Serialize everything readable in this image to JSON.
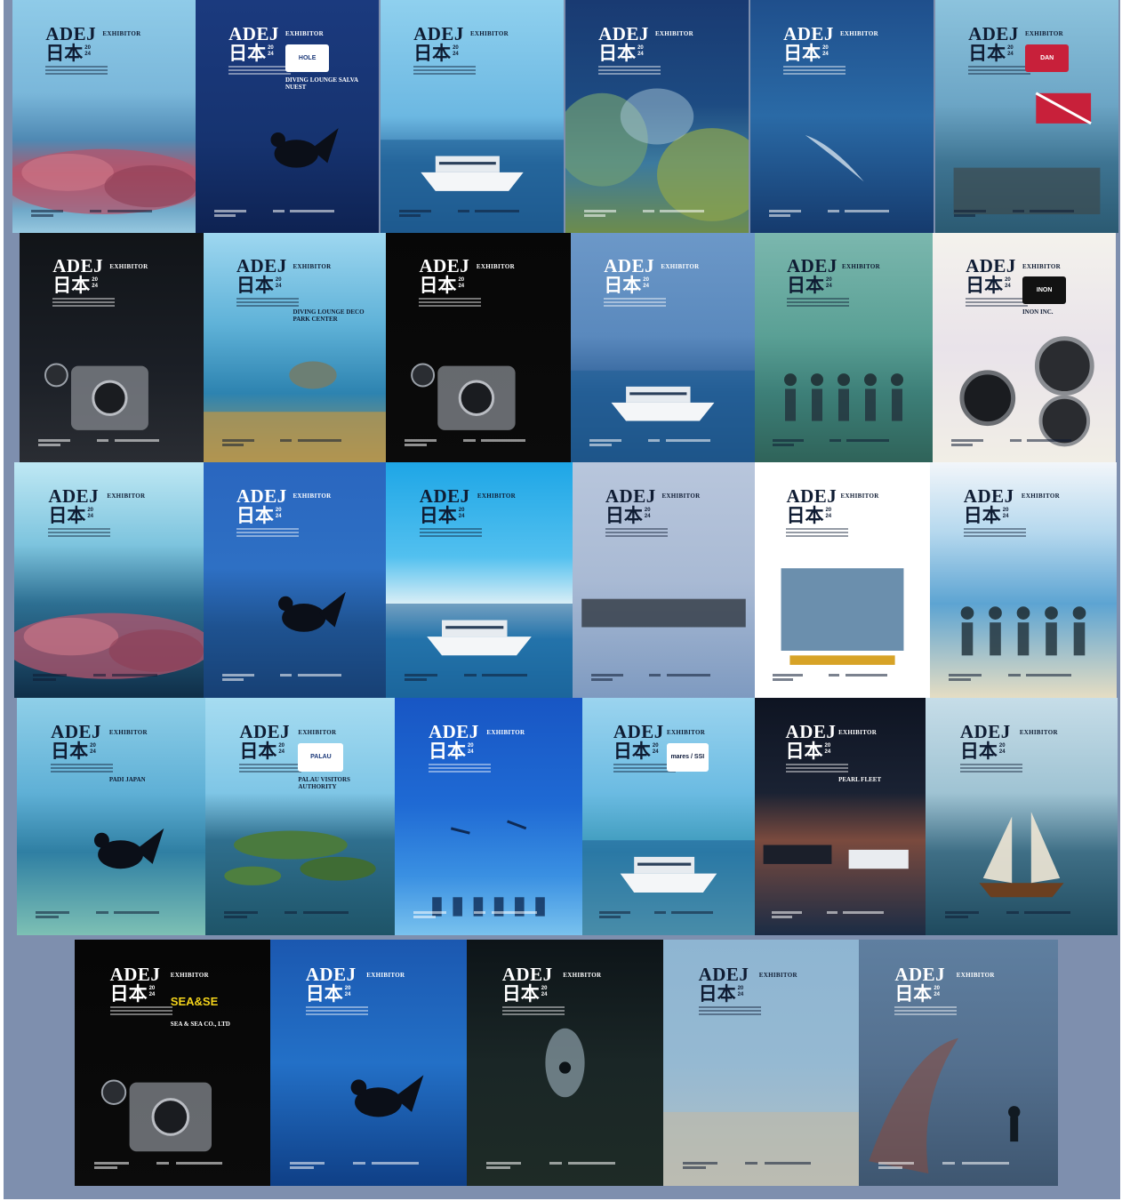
{
  "posters": [
    {
      "row": 1,
      "tag": "EXHIBITOR",
      "logo": "",
      "exhibitor": "",
      "bg": "linear-gradient(180deg,#8fcbe8 0%,#7ab7da 40%,#4f89b3 60%,#b5566a 75%,#6fa8c8 90%,#97c8e0 100%)",
      "text": "#0f1c33",
      "subject": "reef"
    },
    {
      "row": 1,
      "tag": "EXHIBITOR",
      "logo": "HOLE",
      "exhibitor": "DIVING LOUNGE SALVA NUEST",
      "bg": "linear-gradient(180deg,#1b3a7e 0%,#163370 60%,#0e2252 100%)",
      "text": "#ffffff",
      "subject": "diver"
    },
    {
      "row": 1,
      "tag": "EXHIBITOR",
      "logo": "",
      "exhibitor": "",
      "bg": "linear-gradient(180deg,#8fd0ee 0%,#6cb8e2 50%,#2f6fa4 70%,#1f5487 100%)",
      "text": "#0f1c33",
      "subject": "yacht"
    },
    {
      "row": 1,
      "tag": "EXHIBITOR",
      "logo": "",
      "exhibitor": "",
      "bg": "linear-gradient(180deg,#193a72 0%,#1d4b82 45%,#3c7a9e 70%,#6d8c4c 100%)",
      "text": "#ffffff",
      "subject": "coral"
    },
    {
      "row": 1,
      "tag": "EXHIBITOR",
      "logo": "",
      "exhibitor": "",
      "bg": "linear-gradient(180deg,#1f4f8c 0%,#2a6aa6 50%,#153a6d 100%)",
      "text": "#ffffff",
      "subject": "whale"
    },
    {
      "row": 1,
      "tag": "EXHIBITOR",
      "logo": "DAN",
      "exhibitor": "",
      "bg": "linear-gradient(180deg,#8cc3dd 0%,#6ca5c5 45%,#3e7492 70%,#2b5a72 100%)",
      "text": "#0f1c33",
      "subject": "wreck"
    },
    {
      "row": 2,
      "tag": "EXHIBITOR",
      "logo": "",
      "exhibitor": "",
      "bg": "linear-gradient(180deg,#111418 0%,#1b1f26 60%,#2a2d33 100%)",
      "text": "#ffffff",
      "subject": "housing"
    },
    {
      "row": 2,
      "tag": "EXHIBITOR",
      "logo": "",
      "exhibitor": "DIVING LOUNGE DECO PARK CENTER",
      "bg": "linear-gradient(180deg,#9ed7f0 0%,#5fb2d8 40%,#2d83b0 70%,#b29a55 100%)",
      "text": "#0f1c33",
      "subject": "turtle"
    },
    {
      "row": 2,
      "tag": "EXHIBITOR",
      "logo": "",
      "exhibitor": "",
      "bg": "linear-gradient(180deg,#070707 0%,#0b0b0b 100%)",
      "text": "#ffffff",
      "subject": "camera"
    },
    {
      "row": 2,
      "tag": "EXHIBITOR",
      "logo": "",
      "exhibitor": "",
      "bg": "linear-gradient(180deg,#6c98c8 0%,#5a89bd 45%,#2c5d95 70%,#1f4a7b 100%)",
      "text": "#ffffff",
      "subject": "yacht2"
    },
    {
      "row": 2,
      "tag": "EXHIBITOR",
      "logo": "",
      "exhibitor": "",
      "bg": "linear-gradient(180deg,#7bb7ae 0%,#5aa095 45%,#3d7f78 70%,#2f6359 100%)",
      "text": "#0f1c33",
      "subject": "divers"
    },
    {
      "row": 2,
      "tag": "EXHIBITOR",
      "logo": "INON",
      "exhibitor": "INON INC.",
      "bg": "linear-gradient(180deg,#f4f2ec 0%,#e9e3ea 50%,#f1eee6 100%)",
      "text": "#0f1c33",
      "subject": "lens"
    },
    {
      "row": 3,
      "tag": "EXHIBITOR",
      "logo": "",
      "exhibitor": "",
      "bg": "linear-gradient(180deg,#bfe8f4 0%,#7dc4de 35%,#2d6f92 60%,#0f2e48 100%)",
      "text": "#0f1c33",
      "subject": "reef2"
    },
    {
      "row": 3,
      "tag": "EXHIBITOR",
      "logo": "",
      "exhibitor": "",
      "bg": "linear-gradient(180deg,#2a66bf 0%,#2e70c4 45%,#1e5290 70%,#174074 100%)",
      "text": "#ffffff",
      "subject": "diver2"
    },
    {
      "row": 3,
      "tag": "EXHIBITOR",
      "logo": "",
      "exhibitor": "",
      "bg": "linear-gradient(180deg,#1ea6e6 0%,#52c0ef 40%,#d9eef6 60%,#2b8cc4 75%,#1a6ea4 100%)",
      "text": "#0f1c33",
      "subject": "boats"
    },
    {
      "row": 3,
      "tag": "EXHIBITOR",
      "logo": "",
      "exhibitor": "",
      "bg": "linear-gradient(180deg,#b8c6dc 0%,#a9bad4 50%,#7e9ac0 100%)",
      "text": "#0f1c33",
      "subject": "gear"
    },
    {
      "row": 3,
      "tag": "EXHIBITOR",
      "logo": "",
      "exhibitor": "",
      "bg": "linear-gradient(180deg,#ffffff 0%,#ffffff 100%)",
      "text": "#0f1c33",
      "subject": "flyer"
    },
    {
      "row": 3,
      "tag": "EXHIBITOR",
      "logo": "",
      "exhibitor": "",
      "bg": "linear-gradient(180deg,#f2f6fa 0%,#b5d8ee 30%,#5da4d2 60%,#e5ddc3 100%)",
      "text": "#0f1c33",
      "subject": "people"
    },
    {
      "row": 4,
      "tag": "EXHIBITOR",
      "logo": "",
      "exhibitor": "PADI JAPAN",
      "bg": "linear-gradient(180deg,#8fcfe8 0%,#5fb0d6 40%,#2f7fa3 65%,#7dc0b4 100%)",
      "text": "#0f1c33",
      "subject": "diver3"
    },
    {
      "row": 4,
      "tag": "EXHIBITOR",
      "logo": "PALAU",
      "exhibitor": "PALAU VISITORS AUTHORITY",
      "bg": "linear-gradient(180deg,#a6dcf1 0%,#7fc6e6 40%,#2f6f8e 60%,#1e5468 100%)",
      "text": "#0f1c33",
      "subject": "islands"
    },
    {
      "row": 4,
      "tag": "EXHIBITOR",
      "logo": "",
      "exhibitor": "",
      "bg": "linear-gradient(180deg,#1856c4 0%,#1f6ad4 45%,#3a90e2 75%,#79c2ee 100%)",
      "text": "#ffffff",
      "subject": "freedivers"
    },
    {
      "row": 4,
      "tag": "EXHIBITOR",
      "logo": "mares / SSI",
      "exhibitor": "",
      "bg": "linear-gradient(180deg,#9bd4ef 0%,#6bbbe2 40%,#3a98b9 65%,#7ec4c0 100%)",
      "text": "#0f1c33",
      "subject": "boat3"
    },
    {
      "row": 4,
      "tag": "EXHIBITOR",
      "logo": "",
      "exhibitor": "PEARL FLEET",
      "bg": "linear-gradient(180deg,#0e1422 0%,#1a2233 40%,#7a4a3e 60%,#1b2c45 100%)",
      "text": "#ffffff",
      "subject": "sunset"
    },
    {
      "row": 4,
      "tag": "EXHIBITOR",
      "logo": "",
      "exhibitor": "",
      "bg": "linear-gradient(180deg,#c6dde8 0%,#9fc3d3 40%,#3f6f86 65%,#1f4a5e 100%)",
      "text": "#0f1c33",
      "subject": "phinisi"
    },
    {
      "row": 5,
      "tag": "EXHIBITOR",
      "logo": "SEA&SEA",
      "exhibitor": "SEA & SEA CO., LTD",
      "bg": "linear-gradient(180deg,#060606 0%,#0b0b0b 100%)",
      "text": "#ffffff",
      "subject": "housing2"
    },
    {
      "row": 5,
      "tag": "EXHIBITOR",
      "logo": "",
      "exhibitor": "",
      "bg": "linear-gradient(180deg,#1b58b0 0%,#2370c7 50%,#0f3f86 100%)",
      "text": "#ffffff",
      "subject": "diver4"
    },
    {
      "row": 5,
      "tag": "EXHIBITOR",
      "logo": "",
      "exhibitor": "",
      "bg": "linear-gradient(180deg,#0d1418 0%,#1a2626 50%,#1e2b26 100%)",
      "text": "#ffffff",
      "subject": "cave"
    },
    {
      "row": 5,
      "tag": "EXHIBITOR",
      "logo": "",
      "exhibitor": "",
      "bg": "linear-gradient(180deg,#8eb5d2 0%,#95b9d2 50%,#b3c0c4 100%)",
      "text": "#0f1c33",
      "subject": "sand"
    },
    {
      "row": 5,
      "tag": "EXHIBITOR",
      "logo": "",
      "exhibitor": "",
      "bg": "linear-gradient(180deg,#5f7fa0 0%,#54708f 50%,#3e5670 100%)",
      "text": "#ffffff",
      "subject": "fan"
    }
  ],
  "brand": {
    "adej": "ADEJ",
    "nihon": "日本",
    "year_top": "20",
    "year_bottom": "24"
  }
}
